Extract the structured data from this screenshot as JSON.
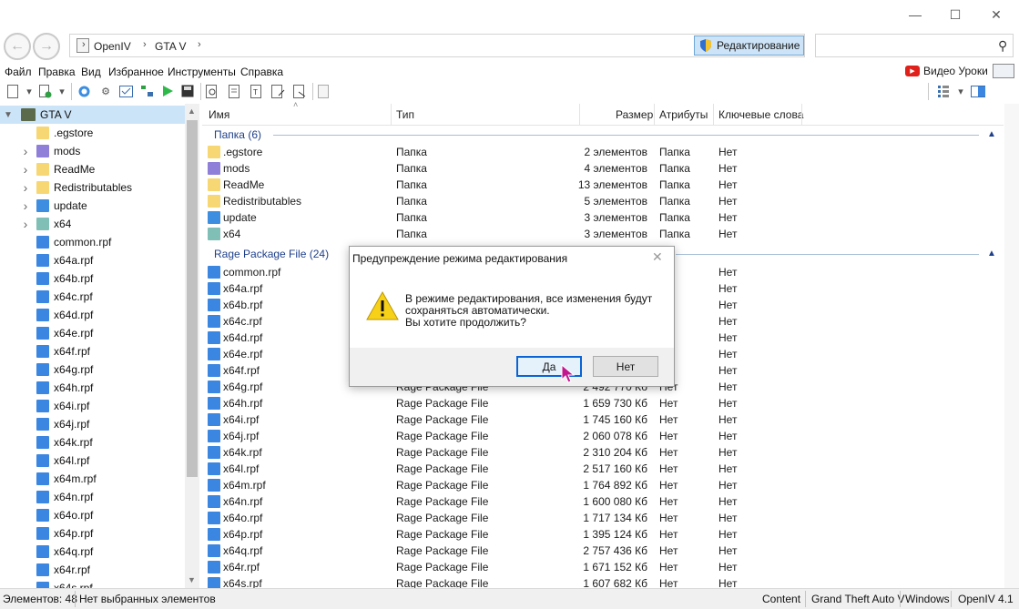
{
  "nav": {
    "breadcrumb": [
      "OpenIV",
      "GTA V"
    ],
    "edit_mode_label": "Редактирование",
    "search_placeholder": ""
  },
  "menu": {
    "items": [
      "Файл",
      "Правка",
      "Вид",
      "Избранное",
      "Инструменты",
      "Справка"
    ],
    "video_label": "Видео Уроки"
  },
  "tree": {
    "root": "GTA V",
    "items": [
      {
        "label": ".egstore",
        "icon": "folder-icon",
        "expandable": false
      },
      {
        "label": "mods",
        "icon": "folder-purple-icon",
        "expandable": true
      },
      {
        "label": "ReadMe",
        "icon": "folder-icon",
        "expandable": true
      },
      {
        "label": "Redistributables",
        "icon": "folder-icon",
        "expandable": true
      },
      {
        "label": "update",
        "icon": "folder-blue-icon",
        "expandable": true
      },
      {
        "label": "x64",
        "icon": "folder-teal-icon",
        "expandable": true
      },
      {
        "label": "common.rpf",
        "icon": "rpf-icon",
        "expandable": false
      },
      {
        "label": "x64a.rpf",
        "icon": "rpf-icon",
        "expandable": false
      },
      {
        "label": "x64b.rpf",
        "icon": "rpf-icon",
        "expandable": false
      },
      {
        "label": "x64c.rpf",
        "icon": "rpf-icon",
        "expandable": false
      },
      {
        "label": "x64d.rpf",
        "icon": "rpf-icon",
        "expandable": false
      },
      {
        "label": "x64e.rpf",
        "icon": "rpf-icon",
        "expandable": false
      },
      {
        "label": "x64f.rpf",
        "icon": "rpf-icon",
        "expandable": false
      },
      {
        "label": "x64g.rpf",
        "icon": "rpf-icon",
        "expandable": false
      },
      {
        "label": "x64h.rpf",
        "icon": "rpf-icon",
        "expandable": false
      },
      {
        "label": "x64i.rpf",
        "icon": "rpf-icon",
        "expandable": false
      },
      {
        "label": "x64j.rpf",
        "icon": "rpf-icon",
        "expandable": false
      },
      {
        "label": "x64k.rpf",
        "icon": "rpf-icon",
        "expandable": false
      },
      {
        "label": "x64l.rpf",
        "icon": "rpf-icon",
        "expandable": false
      },
      {
        "label": "x64m.rpf",
        "icon": "rpf-icon",
        "expandable": false
      },
      {
        "label": "x64n.rpf",
        "icon": "rpf-icon",
        "expandable": false
      },
      {
        "label": "x64o.rpf",
        "icon": "rpf-icon",
        "expandable": false
      },
      {
        "label": "x64p.rpf",
        "icon": "rpf-icon",
        "expandable": false
      },
      {
        "label": "x64q.rpf",
        "icon": "rpf-icon",
        "expandable": false
      },
      {
        "label": "x64r.rpf",
        "icon": "rpf-icon",
        "expandable": false
      },
      {
        "label": "x64s.rpf",
        "icon": "rpf-icon",
        "expandable": false
      }
    ]
  },
  "columns": {
    "name": "Имя",
    "type": "Тип",
    "size": "Размер",
    "attributes": "Атрибуты",
    "keywords": "Ключевые слова"
  },
  "groups": {
    "folders": "Папка (6)",
    "rpf": "Rage Package File (24)"
  },
  "folders": [
    {
      "name": ".egstore",
      "type": "Папка",
      "size": "2 элементов",
      "attr": "Папка",
      "kw": "Нет",
      "icon": "folder-icon"
    },
    {
      "name": "mods",
      "type": "Папка",
      "size": "4 элементов",
      "attr": "Папка",
      "kw": "Нет",
      "icon": "folder-purple-icon"
    },
    {
      "name": "ReadMe",
      "type": "Папка",
      "size": "13 элементов",
      "attr": "Папка",
      "kw": "Нет",
      "icon": "folder-icon"
    },
    {
      "name": "Redistributables",
      "type": "Папка",
      "size": "5 элементов",
      "attr": "Папка",
      "kw": "Нет",
      "icon": "folder-icon"
    },
    {
      "name": "update",
      "type": "Папка",
      "size": "3 элементов",
      "attr": "Папка",
      "kw": "Нет",
      "icon": "folder-blue-icon"
    },
    {
      "name": "x64",
      "type": "Папка",
      "size": "3 элементов",
      "attr": "Папка",
      "kw": "Нет",
      "icon": "folder-teal-icon"
    }
  ],
  "rpf_files": [
    {
      "name": "common.rpf",
      "type": "",
      "size": "",
      "attr": "",
      "kw": "Нет"
    },
    {
      "name": "x64a.rpf",
      "type": "",
      "size": "",
      "attr": "",
      "kw": "Нет"
    },
    {
      "name": "x64b.rpf",
      "type": "",
      "size": "",
      "attr": "",
      "kw": "Нет"
    },
    {
      "name": "x64c.rpf",
      "type": "",
      "size": "",
      "attr": "",
      "kw": "Нет"
    },
    {
      "name": "x64d.rpf",
      "type": "",
      "size": "",
      "attr": "",
      "kw": "Нет"
    },
    {
      "name": "x64e.rpf",
      "type": "",
      "size": "",
      "attr": "",
      "kw": "Нет"
    },
    {
      "name": "x64f.rpf",
      "type": "",
      "size": "",
      "attr": "",
      "kw": "Нет"
    },
    {
      "name": "x64g.rpf",
      "type": "Rage Package File",
      "size": "2 492 770 Кб",
      "attr": "Нет",
      "kw": "Нет"
    },
    {
      "name": "x64h.rpf",
      "type": "Rage Package File",
      "size": "1 659 730 Кб",
      "attr": "Нет",
      "kw": "Нет"
    },
    {
      "name": "x64i.rpf",
      "type": "Rage Package File",
      "size": "1 745 160 Кб",
      "attr": "Нет",
      "kw": "Нет"
    },
    {
      "name": "x64j.rpf",
      "type": "Rage Package File",
      "size": "2 060 078 Кб",
      "attr": "Нет",
      "kw": "Нет"
    },
    {
      "name": "x64k.rpf",
      "type": "Rage Package File",
      "size": "2 310 204 Кб",
      "attr": "Нет",
      "kw": "Нет"
    },
    {
      "name": "x64l.rpf",
      "type": "Rage Package File",
      "size": "2 517 160 Кб",
      "attr": "Нет",
      "kw": "Нет"
    },
    {
      "name": "x64m.rpf",
      "type": "Rage Package File",
      "size": "1 764 892 Кб",
      "attr": "Нет",
      "kw": "Нет"
    },
    {
      "name": "x64n.rpf",
      "type": "Rage Package File",
      "size": "1 600 080 Кб",
      "attr": "Нет",
      "kw": "Нет"
    },
    {
      "name": "x64o.rpf",
      "type": "Rage Package File",
      "size": "1 717 134 Кб",
      "attr": "Нет",
      "kw": "Нет"
    },
    {
      "name": "x64p.rpf",
      "type": "Rage Package File",
      "size": "1 395 124 Кб",
      "attr": "Нет",
      "kw": "Нет"
    },
    {
      "name": "x64q.rpf",
      "type": "Rage Package File",
      "size": "2 757 436 Кб",
      "attr": "Нет",
      "kw": "Нет"
    },
    {
      "name": "x64r.rpf",
      "type": "Rage Package File",
      "size": "1 671 152 Кб",
      "attr": "Нет",
      "kw": "Нет"
    },
    {
      "name": "x64s.rpf",
      "type": "Rage Package File",
      "size": "1 607 682 Кб",
      "attr": "Нет",
      "kw": "Нет"
    }
  ],
  "status": {
    "count": "Элементов: 48",
    "selection": "Нет выбранных элементов",
    "content": "Content",
    "game": "Grand Theft Auto V",
    "platform": "Windows",
    "version": "OpenIV 4.1"
  },
  "dialog": {
    "title": "Предупреждение режима редактирования",
    "message_lines": [
      "В режиме редактирования, все изменения будут",
      "сохраняться автоматически.",
      "Вы хотите продолжить?"
    ],
    "yes_label": "Да",
    "no_label": "Нет"
  },
  "colors": {
    "folder": "#f7d774",
    "folder_purple": "#8f7fd8",
    "folder_blue": "#3d8ee0",
    "folder_teal": "#7fbfb5",
    "rpf": "#3a86e0",
    "group_text": "#1e3f8a",
    "accent": "#0a64d6"
  }
}
